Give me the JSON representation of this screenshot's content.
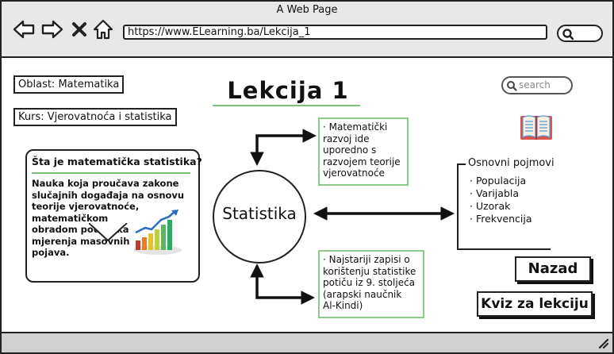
{
  "window": {
    "title": "A Web Page",
    "url": "https://www.ELearning.ba/Lekcija_1"
  },
  "nav": {
    "back_icon": "arrow-left-icon",
    "forward_icon": "arrow-right-icon",
    "close_icon": "close-icon",
    "home_icon": "home-icon"
  },
  "meta": {
    "area_label": "Oblast: Matematika",
    "course_label": "Kurs: Vjerovatnoća i statistika"
  },
  "page": {
    "title": "Lekcija 1",
    "search_placeholder": "search"
  },
  "callout": {
    "title": "Šta je matematička statistika?",
    "body_lines": [
      "Nauka koja proučava zakone",
      "slučajnih događaja na osnovu",
      "teorije vjerovatnoće,",
      "matematičkom",
      "obradom podataka",
      "mjerenja masovnih",
      "pojava."
    ]
  },
  "diagram": {
    "center_label": "Statistika",
    "note_top_lines": [
      "· Matematički",
      "razvoj ide",
      "uporedno s",
      "razvojem teorije",
      "vjerovatnoće"
    ],
    "note_bottom_lines": [
      "· Najstariji zapisi o",
      "korištenju statistike",
      "potiču iz 9. stoljeća",
      " (arapski naučnik",
      "Al-Kindi)"
    ],
    "concepts_title": "Osnovni pojmovi",
    "concepts": [
      "Populacija",
      "Varijabla",
      "Uzorak",
      "Frekvencija"
    ]
  },
  "buttons": {
    "back_label": "Nazad",
    "quiz_label": "Kviz za lekciju"
  },
  "colors": {
    "accent_green": "#7dc07a",
    "chrome_bg": "#e8e8e8"
  }
}
